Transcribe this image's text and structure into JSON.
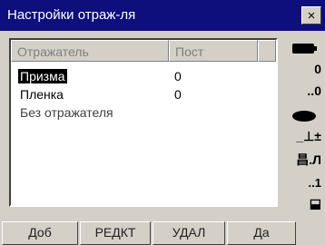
{
  "window": {
    "title": "Настройки отраж-ля",
    "close_label": "×"
  },
  "list": {
    "columns": [
      "Отражатель",
      "Пост"
    ],
    "rows": [
      {
        "name": "Призма",
        "constant": "0",
        "selected": true
      },
      {
        "name": "Пленка",
        "constant": "0",
        "selected": false
      },
      {
        "name": "Без отражателя",
        "constant": "",
        "selected": false
      }
    ]
  },
  "status_icons": [
    {
      "name": "battery-icon"
    },
    {
      "name": "compensator-icon",
      "text": "0"
    },
    {
      "name": "mode-icon",
      "text": "..0"
    },
    {
      "name": "prism-icon"
    },
    {
      "name": "level-icon",
      "text": "_⊥±"
    },
    {
      "name": "memory-icon",
      "text": "昌.Л"
    },
    {
      "name": "page-icon",
      "text": "..1"
    },
    {
      "name": "input-mode-icon",
      "text": "⬓"
    }
  ],
  "softkeys": {
    "add": "Доб",
    "edit": "РЕДКТ",
    "delete": "УДАЛ",
    "yes": "Да"
  },
  "colors": {
    "titlebar": "#0e0e7c",
    "background": "#d4d0c8",
    "selection": "#000000"
  }
}
